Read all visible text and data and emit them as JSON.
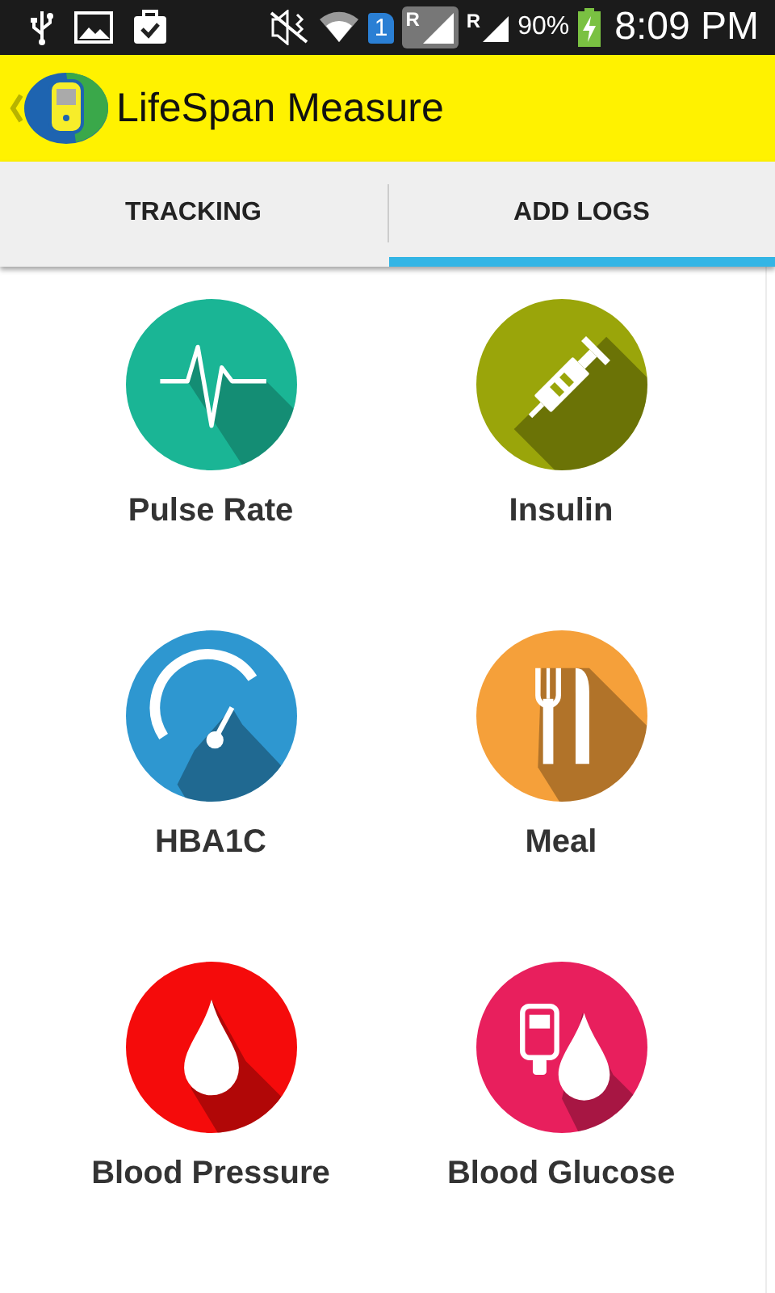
{
  "status_bar": {
    "sim_badge": "1",
    "roaming": [
      "R",
      "R"
    ],
    "battery": "90%",
    "time": "8:09 PM"
  },
  "app_bar": {
    "title": "LifeSpan Measure"
  },
  "tabs": [
    {
      "label": "TRACKING",
      "selected": false
    },
    {
      "label": "ADD LOGS",
      "selected": true
    }
  ],
  "tiles": [
    {
      "label": "Pulse Rate",
      "kind": "pulse",
      "color": "#1ab595"
    },
    {
      "label": "Insulin",
      "kind": "syringe",
      "color": "#9aa50a"
    },
    {
      "label": "HBA1C",
      "kind": "gauge",
      "color": "#2e97d0"
    },
    {
      "label": "Meal",
      "kind": "meal",
      "color": "#f5a03a"
    },
    {
      "label": "Blood Pressure",
      "kind": "drop",
      "color": "#f50b0b"
    },
    {
      "label": "Blood Glucose",
      "kind": "glucose",
      "color": "#e81f5d"
    }
  ]
}
